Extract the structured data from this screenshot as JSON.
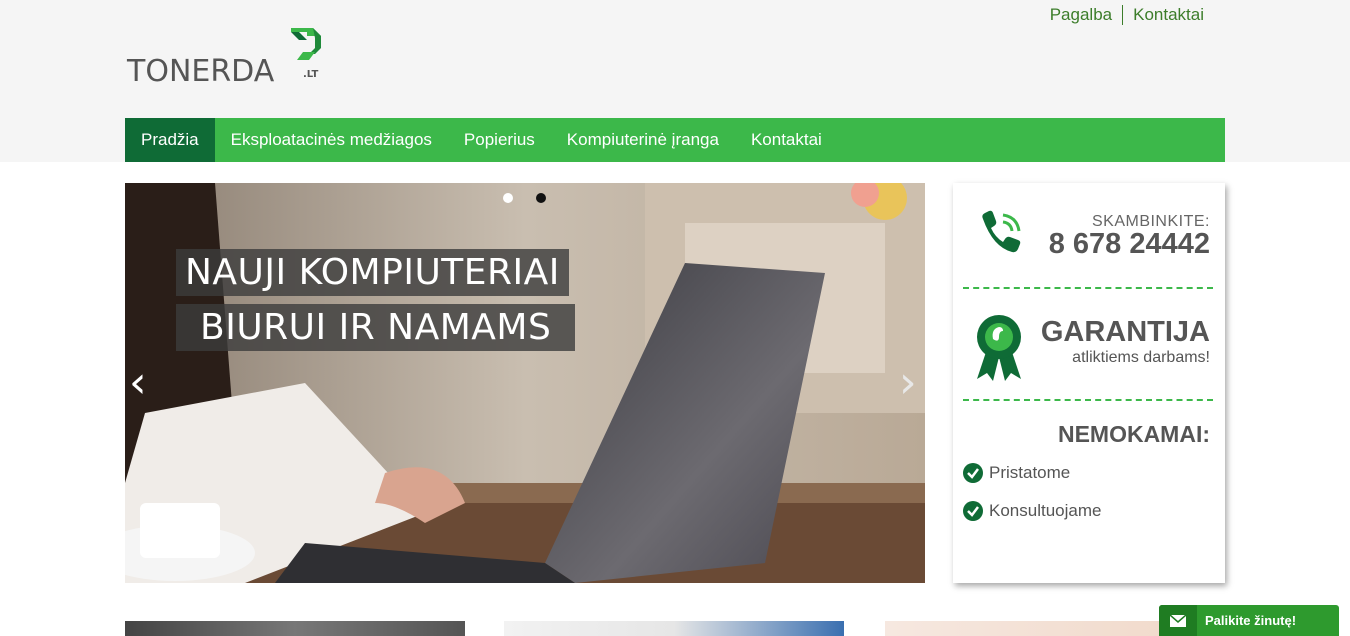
{
  "header": {
    "logo_text": "TONERDA",
    "logo_suffix": ".LT",
    "top_links": [
      "Pagalba",
      "Kontaktai"
    ]
  },
  "nav": {
    "items": [
      "Pradžia",
      "Eksploatacinės medžiagos",
      "Popierius",
      "Kompiuterinė įranga",
      "Kontaktai"
    ],
    "active_index": 0
  },
  "slider": {
    "caption_line1": "NAUJI KOMPIUTERIAI",
    "caption_line2": "BIURUI IR NAMAMS",
    "prev_arrow": "‹",
    "next_arrow": "›",
    "slide_count": 2,
    "active_slide": 1
  },
  "sidebar": {
    "phone_label": "SKAMBINKITE:",
    "phone_number": "8 678 24442",
    "guarantee_title": "GARANTIJA",
    "guarantee_sub": "atliktiems darbams!",
    "free_title": "NEMOKAMAI:",
    "free_items": [
      "Pristatome",
      "Konsultuojame"
    ]
  },
  "message_button": {
    "label": "Palikite žinutę!"
  },
  "colors": {
    "nav_green": "#3cb84a",
    "nav_active": "#0f6b36",
    "link_green": "#3c7d2a",
    "accent_dark_green": "#0f6b36"
  }
}
